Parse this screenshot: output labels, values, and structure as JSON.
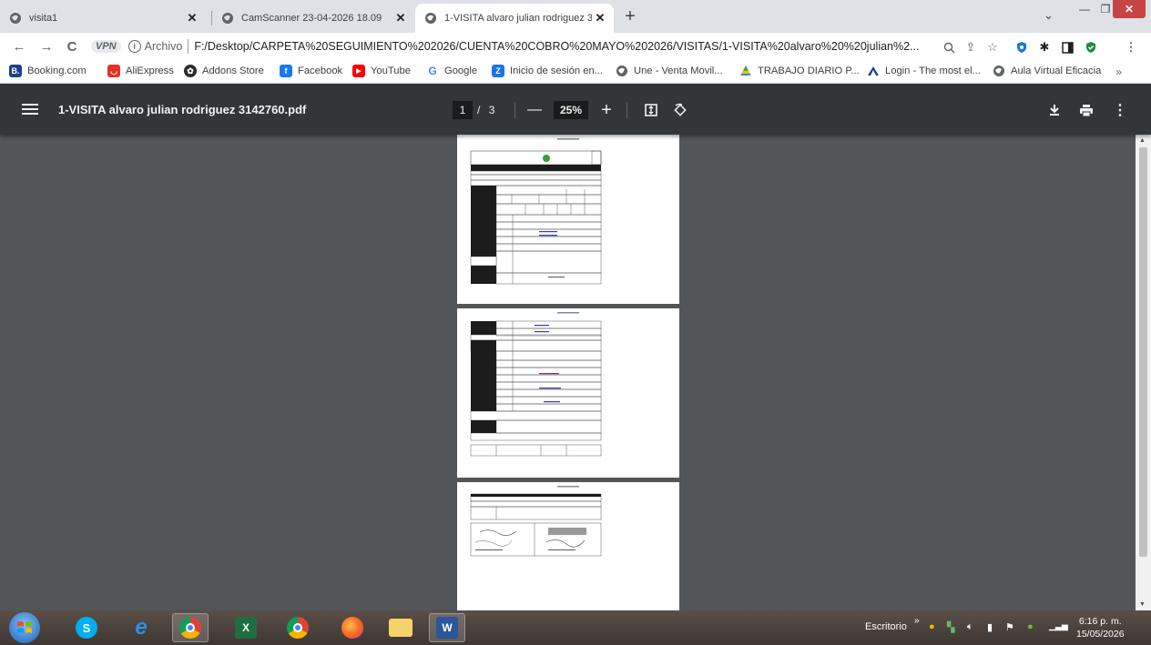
{
  "tabs": [
    {
      "title": "visita1",
      "active": false
    },
    {
      "title": "CamScanner 23-04-2026 18.09",
      "active": false
    },
    {
      "title": "1-VISITA alvaro julian rodriguez 3",
      "active": true
    }
  ],
  "toolbar": {
    "vpn_label": "VPN",
    "security_label": "Archivo",
    "url": "F:/Desktop/CARPETA%20SEGUIMIENTO%202026/CUENTA%20COBRO%20MAYO%202026/VISITAS/1-VISITA%20alvaro%20%20julian%2..."
  },
  "bookmarks": [
    {
      "label": "Booking.com",
      "icon": "booking-icon",
      "color": "#1a3f8f",
      "glyph": "B."
    },
    {
      "label": "AliExpress",
      "icon": "aliexpress-icon",
      "color": "#e43225",
      "glyph": "◡"
    },
    {
      "label": "Addons Store",
      "icon": "addons-icon",
      "color": "#2b2b2b",
      "glyph": "●"
    },
    {
      "label": "Facebook",
      "icon": "facebook-icon",
      "color": "#1877f2",
      "glyph": "f"
    },
    {
      "label": "YouTube",
      "icon": "youtube-icon",
      "color": "#ff0000",
      "glyph": "▶"
    },
    {
      "label": "Google",
      "icon": "google-icon",
      "color": "#ffffff",
      "glyph": "G"
    },
    {
      "label": "Inicio de sesión en...",
      "icon": "login-icon",
      "color": "#1a73e8",
      "glyph": "Z"
    },
    {
      "label": "Une - Venta Movil...",
      "icon": "globe-icon",
      "color": "#5f6368",
      "glyph": "●"
    },
    {
      "label": "TRABAJO DIARIO P...",
      "icon": "drive-icon",
      "color": "#fbbc04",
      "glyph": "▲"
    },
    {
      "label": "Login - The most el...",
      "icon": "login-site-icon",
      "color": "#1a3f8f",
      "glyph": "▲"
    },
    {
      "label": "Aula Virtual Eficacia",
      "icon": "globe-icon",
      "color": "#5f6368",
      "glyph": "●"
    }
  ],
  "pdf": {
    "title": "1-VISITA alvaro julian rodriguez 3142760.pdf",
    "current_page": "1",
    "page_separator": "/",
    "total_pages": "3",
    "zoom": "25%"
  },
  "taskbar": {
    "desktop_label": "Escritorio",
    "time": "6:16 p. m.",
    "date": "15/05/2026"
  },
  "colors": {
    "pdf_toolbar": "#323639",
    "pdf_background": "#525659",
    "close_button": "#c74444"
  }
}
